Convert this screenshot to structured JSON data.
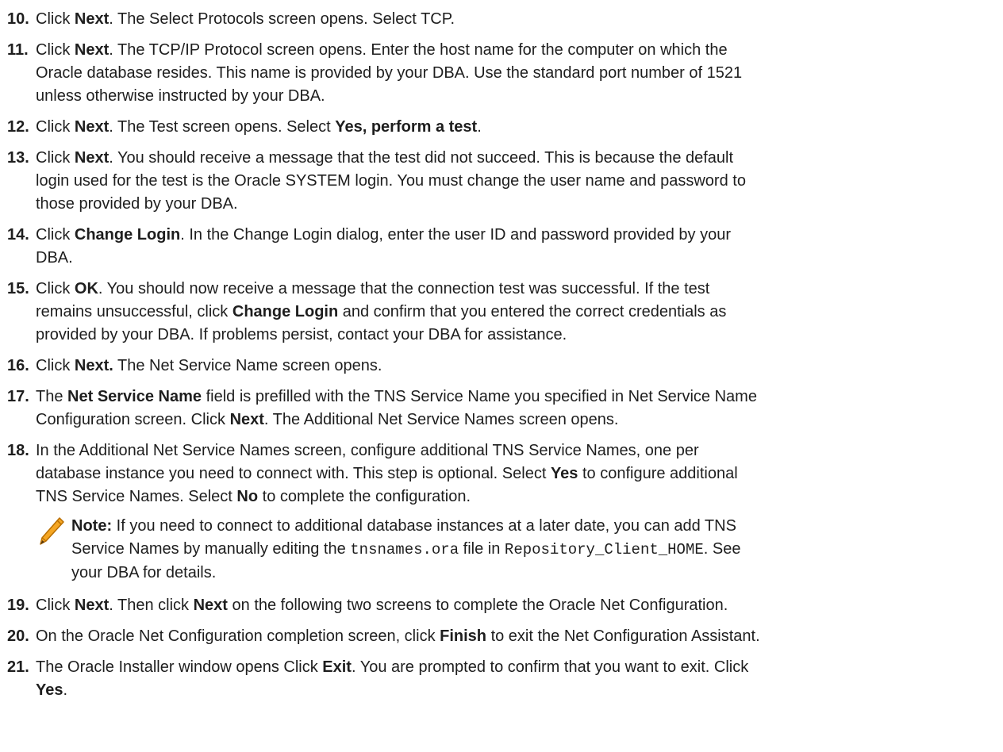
{
  "steps": [
    {
      "num": "10.",
      "parts": [
        [
          "t",
          "Click "
        ],
        [
          "b",
          "Next"
        ],
        [
          "t",
          ". The Select Protocols screen opens. Select TCP."
        ]
      ]
    },
    {
      "num": "11.",
      "parts": [
        [
          "t",
          "Click "
        ],
        [
          "b",
          "Next"
        ],
        [
          "t",
          ". The TCP/IP Protocol screen opens. Enter the host name for the computer on which the"
        ],
        [
          "br",
          ""
        ],
        [
          "t",
          "Oracle database resides. This name is provided by your DBA. Use the standard port number of 1521"
        ],
        [
          "br",
          ""
        ],
        [
          "t",
          "unless otherwise instructed by your DBA."
        ]
      ]
    },
    {
      "num": "12.",
      "parts": [
        [
          "t",
          "Click "
        ],
        [
          "b",
          "Next"
        ],
        [
          "t",
          ". The Test screen opens. Select "
        ],
        [
          "b",
          "Yes, perform a test"
        ],
        [
          "t",
          "."
        ]
      ]
    },
    {
      "num": "13.",
      "parts": [
        [
          "t",
          "Click "
        ],
        [
          "b",
          "Next"
        ],
        [
          "t",
          ". You should receive a message that the test did not succeed. This is because the default"
        ],
        [
          "br",
          ""
        ],
        [
          "t",
          "login used for the test is the Oracle SYSTEM login. You must change the user name and password to"
        ],
        [
          "br",
          ""
        ],
        [
          "t",
          "those provided by your DBA."
        ]
      ]
    },
    {
      "num": "14.",
      "parts": [
        [
          "t",
          "Click "
        ],
        [
          "b",
          "Change Login"
        ],
        [
          "t",
          ". In the Change Login dialog, enter the user ID and password provided by your"
        ],
        [
          "br",
          ""
        ],
        [
          "t",
          "DBA."
        ]
      ]
    },
    {
      "num": "15.",
      "parts": [
        [
          "t",
          "Click "
        ],
        [
          "b",
          "OK"
        ],
        [
          "t",
          ". You should now receive a message that the connection test was successful. If the test"
        ],
        [
          "br",
          ""
        ],
        [
          "t",
          "remains unsuccessful, click "
        ],
        [
          "b",
          "Change Login"
        ],
        [
          "t",
          " and confirm that you entered the correct credentials as"
        ],
        [
          "br",
          ""
        ],
        [
          "t",
          "provided by your DBA. If problems persist, contact your DBA for assistance."
        ]
      ]
    },
    {
      "num": "16.",
      "parts": [
        [
          "t",
          "Click "
        ],
        [
          "b",
          "Next."
        ],
        [
          "t",
          " The Net Service Name screen opens."
        ]
      ]
    },
    {
      "num": "17.",
      "parts": [
        [
          "t",
          "The "
        ],
        [
          "b",
          "Net Service Name"
        ],
        [
          "t",
          " field is prefilled with the TNS Service Name you specified in Net Service Name"
        ],
        [
          "br",
          ""
        ],
        [
          "t",
          "Configuration screen. Click "
        ],
        [
          "b",
          "Next"
        ],
        [
          "t",
          ". The Additional Net Service Names screen opens."
        ]
      ]
    },
    {
      "num": "18.",
      "parts": [
        [
          "t",
          "In the Additional Net Service Names screen, configure additional TNS Service Names, one per"
        ],
        [
          "br",
          ""
        ],
        [
          "t",
          "database instance you need to connect with. This step is optional. Select "
        ],
        [
          "b",
          "Yes"
        ],
        [
          "t",
          " to configure additional"
        ],
        [
          "br",
          ""
        ],
        [
          "t",
          "TNS Service Names. Select "
        ],
        [
          "b",
          "No"
        ],
        [
          "t",
          " to complete the configuration."
        ]
      ]
    },
    {
      "type": "note",
      "parts": [
        [
          "b",
          "Note:"
        ],
        [
          "t",
          " If you need to connect to additional database instances at a later date, you can add TNS"
        ],
        [
          "br",
          ""
        ],
        [
          "t",
          "Service Names by manually editing the "
        ],
        [
          "m",
          "tnsnames.ora"
        ],
        [
          "t",
          " file in "
        ],
        [
          "m",
          "Repository_Client_HOME"
        ],
        [
          "t",
          ". See"
        ],
        [
          "br",
          ""
        ],
        [
          "t",
          "your DBA for details."
        ]
      ]
    },
    {
      "num": "19.",
      "parts": [
        [
          "t",
          "Click "
        ],
        [
          "b",
          "Next"
        ],
        [
          "t",
          ". Then click "
        ],
        [
          "b",
          "Next"
        ],
        [
          "t",
          " on the following two screens to complete the Oracle Net Configuration."
        ]
      ]
    },
    {
      "num": "20.",
      "parts": [
        [
          "t",
          "On the Oracle Net Configuration completion screen, click "
        ],
        [
          "b",
          "Finish"
        ],
        [
          "t",
          " to exit the Net Configuration Assistant."
        ]
      ]
    },
    {
      "num": "21.",
      "parts": [
        [
          "t",
          "The Oracle Installer window opens Click "
        ],
        [
          "b",
          "Exit"
        ],
        [
          "t",
          ". You are prompted to confirm that you want to exit. Click"
        ],
        [
          "br",
          ""
        ],
        [
          "b",
          "Yes"
        ],
        [
          "t",
          "."
        ]
      ]
    }
  ],
  "icons": {
    "note": "pencil-icon"
  },
  "colors": {
    "text": "#1e1e1e",
    "pencil": "#f5a623"
  }
}
